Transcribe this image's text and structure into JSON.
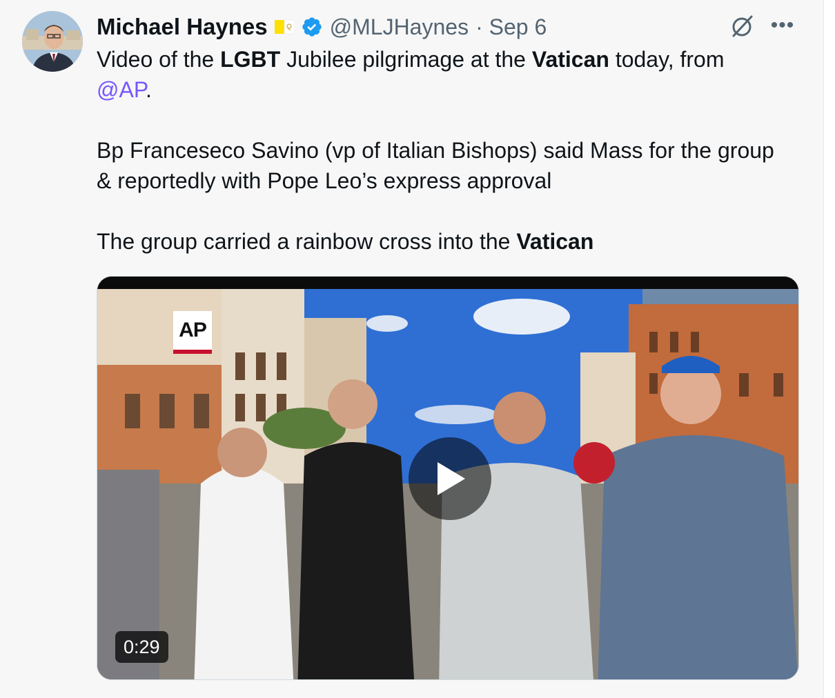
{
  "tweet": {
    "author": {
      "display_name": "Michael Haynes",
      "handle": "@MLJHaynes",
      "date": "· Sep 6",
      "verified": true,
      "flag_icon": "vatican-flag-icon"
    },
    "text": {
      "line1_a": "Video of the ",
      "line1_b": "LGBT",
      "line1_c": " Jubilee pilgrimage at the ",
      "line1_d": "Vatican",
      "line1_e": " today, from ",
      "mention": "@AP",
      "line2_end": ".",
      "paragraph2": "Bp Franceseco Savino (vp of Italian Bishops) said Mass for the group & reportedly with Pope Leo’s express approval",
      "line3_a": "The group carried a rainbow cross into the ",
      "line3_b": "Vatican"
    },
    "media": {
      "type": "video",
      "duration": "0:29",
      "logo_text": "AP"
    },
    "colors": {
      "mention": "#7856ff",
      "verified": "#1d9bf0",
      "secondary_text": "#536471"
    }
  }
}
